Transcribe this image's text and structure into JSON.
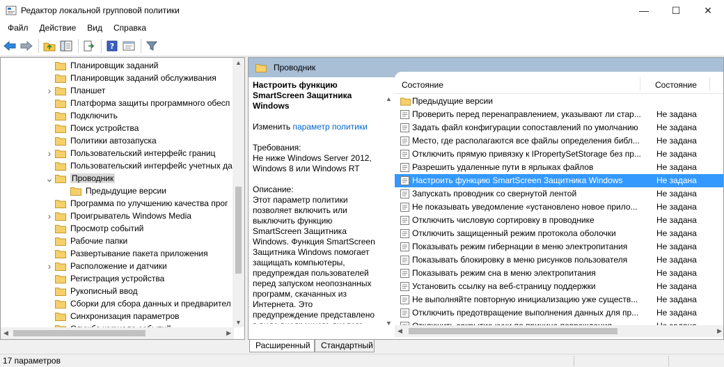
{
  "window": {
    "title": "Редактор локальной групповой политики",
    "minimize": "—",
    "maximize": "☐",
    "close": "✕"
  },
  "menu": [
    "Файл",
    "Действие",
    "Вид",
    "Справка"
  ],
  "toolbar_icons": [
    "back-arrow-icon",
    "forward-arrow-icon",
    "folder-up-icon",
    "show-hide-tree-icon",
    "export-list-icon",
    "help-icon",
    "properties-icon",
    "filter-icon"
  ],
  "tree": {
    "items": [
      {
        "label": "Планировщик заданий",
        "arrow": ""
      },
      {
        "label": "Планировщик заданий обслуживания",
        "arrow": ""
      },
      {
        "label": "Планшет",
        "arrow": ">"
      },
      {
        "label": "Платформа защиты программного обесп",
        "arrow": ""
      },
      {
        "label": "Подключить",
        "arrow": ""
      },
      {
        "label": "Поиск устройства",
        "arrow": ""
      },
      {
        "label": "Политики автозапуска",
        "arrow": ""
      },
      {
        "label": "Пользовательский интерфейс границ",
        "arrow": ">"
      },
      {
        "label": "Пользовательский интерфейс учетных да",
        "arrow": ""
      },
      {
        "label": "Проводник",
        "arrow": "v",
        "selected": true
      },
      {
        "label": "Предыдущие версии",
        "arrow": "",
        "child": true
      },
      {
        "label": "Программа по улучшению качества прог",
        "arrow": ""
      },
      {
        "label": "Проигрыватель Windows Media",
        "arrow": ">"
      },
      {
        "label": "Просмотр событий",
        "arrow": ""
      },
      {
        "label": "Рабочие папки",
        "arrow": ""
      },
      {
        "label": "Развертывание пакета приложения",
        "arrow": ""
      },
      {
        "label": "Расположение и датчики",
        "arrow": ">"
      },
      {
        "label": "Регистрация устройства",
        "arrow": ""
      },
      {
        "label": "Рукописный ввод",
        "arrow": ""
      },
      {
        "label": "Сборки для сбора данных и предварител",
        "arrow": ""
      },
      {
        "label": "Синхронизация параметров",
        "arrow": ""
      },
      {
        "label": "Служба журнала событий",
        "arrow": ">"
      },
      {
        "label": "Служба приложений ActiveX",
        "arrow": ""
      }
    ]
  },
  "right": {
    "header": "Проводник",
    "desc": {
      "title": "Настроить функцию SmartScreen Защитника Windows",
      "edit_prefix": "Изменить ",
      "edit_link": "параметр политики",
      "req_label": "Требования:",
      "req_text": "Не ниже Windows Server 2012, Windows 8 или Windows RT",
      "desc_label": "Описание:",
      "desc_text": "Этот параметр политики позволяет включить или выключить функцию SmartScreen Защитника Windows. Функция SmartScreen Защитника Windows помогает защищать компьютеры, предупреждая пользователей перед запуском неопознанных программ, скачанных из Интернета. Это предупреждение представлено в виде внедренного диалога, показанного перед запуском приложения, загруженного из"
    },
    "columns": {
      "name": "Состояние",
      "state": "Состояние"
    },
    "rows": [
      {
        "name": "Предыдущие версии",
        "state": "",
        "icon": "folder-icon"
      },
      {
        "name": "Проверить перед перенаправлением, указывают ли стар...",
        "state": "Не задана",
        "icon": "policy-setting-icon"
      },
      {
        "name": "Задать файл конфигурации сопоставлений по умолчанию",
        "state": "Не задана",
        "icon": "policy-setting-icon"
      },
      {
        "name": "Место, где располагаются все файлы определения библ...",
        "state": "Не задана",
        "icon": "policy-setting-icon"
      },
      {
        "name": "Отключить прямую привязку к IPropertySetStorage без пр...",
        "state": "Не задана",
        "icon": "policy-setting-icon"
      },
      {
        "name": "Разрешить удаленные пути в ярлыках файлов",
        "state": "Не задана",
        "icon": "policy-setting-icon"
      },
      {
        "name": "Настроить функцию SmartScreen Защитника Windows",
        "state": "Не задана",
        "icon": "policy-setting-icon",
        "selected": true
      },
      {
        "name": "Запускать проводник со свернутой лентой",
        "state": "Не задана",
        "icon": "policy-setting-icon"
      },
      {
        "name": "Не показывать уведомление «установлено новое прило...",
        "state": "Не задана",
        "icon": "policy-setting-icon"
      },
      {
        "name": "Отключить числовую сортировку в проводнике",
        "state": "Не задана",
        "icon": "policy-setting-icon"
      },
      {
        "name": "Отключить защищенный режим протокола оболочки",
        "state": "Не задана",
        "icon": "policy-setting-icon"
      },
      {
        "name": "Показывать режим гибернации в меню электропитания",
        "state": "Не задана",
        "icon": "policy-setting-icon"
      },
      {
        "name": "Показывать блокировку в меню рисунков пользователя",
        "state": "Не задана",
        "icon": "policy-setting-icon"
      },
      {
        "name": "Показывать режим сна в меню электропитания",
        "state": "Не задана",
        "icon": "policy-setting-icon"
      },
      {
        "name": "Установить ссылку на веб-страницу поддержки",
        "state": "Не задана",
        "icon": "policy-setting-icon"
      },
      {
        "name": "Не выполняйте повторную инициализацию уже существ...",
        "state": "Не задана",
        "icon": "policy-setting-icon"
      },
      {
        "name": "Отключить предотвращение выполнения данных для пр...",
        "state": "Не задана",
        "icon": "policy-setting-icon"
      },
      {
        "name": "Отключить закрытие кучи по причине повреждения",
        "state": "Не задана",
        "icon": "policy-setting-icon"
      }
    ]
  },
  "tabs": [
    "Расширенный",
    "Стандартный"
  ],
  "status": {
    "text": "17 параметров"
  },
  "colors": {
    "selection": "#3399ff",
    "header_band": "#a8bfd6",
    "link": "#0066cc"
  }
}
